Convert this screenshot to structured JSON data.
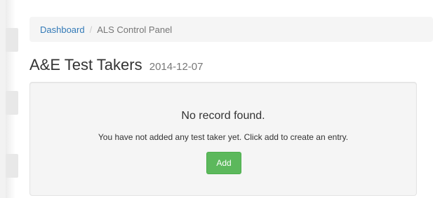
{
  "breadcrumb": {
    "home": "Dashboard",
    "separator": "/",
    "current": "ALS Control Panel"
  },
  "page": {
    "title": "A&E Test Takers",
    "date": "2014-12-07"
  },
  "empty_state": {
    "title": "No record found.",
    "message": "You have not added any test taker yet. Click add to create an entry.",
    "add_label": "Add"
  },
  "colors": {
    "link": "#337ab7",
    "success_button": "#5cb85c"
  }
}
